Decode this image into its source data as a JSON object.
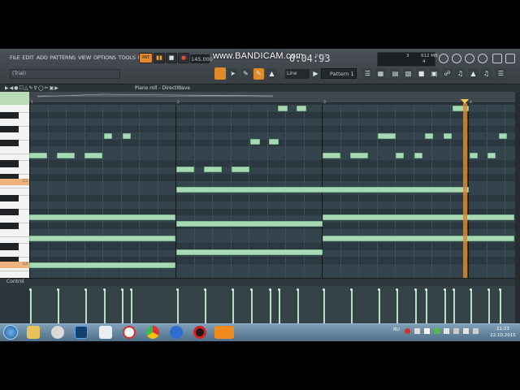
{
  "app": {
    "menu": [
      "FILE",
      "EDIT",
      "ADD",
      "PATTERNS",
      "VIEW",
      "OPTIONS",
      "TOOLS",
      "HELP"
    ],
    "hint": "(Trial)",
    "pat_label": "PAT",
    "tempo": "145.000",
    "watermark": "www.BANDICAM.com",
    "time": "0:04:93",
    "time_sub": "M:S:CS",
    "cpu_value": "3",
    "memory": "612 MB",
    "cpu_poly": "4",
    "snap_mode": "Line",
    "pattern": "Pattern 1",
    "accent": "#e08a2a"
  },
  "piano_roll": {
    "title": "Piano roll - DirectWave",
    "bars": [
      "1",
      "2",
      "3",
      "4"
    ],
    "key_labels": {
      "c5": "C5",
      "c4": "C4"
    },
    "note_color": "#a8d8b4",
    "notes": [
      {
        "row": 4,
        "start": 0.68,
        "len": 0.13,
        "label": "D5"
      },
      {
        "row": 7,
        "start": 3.78,
        "len": 0.07,
        "label": "C5"
      },
      {
        "row": 7,
        "start": 3.91,
        "len": 0.07,
        "label": "C5"
      },
      {
        "row": 7,
        "start": 3.56,
        "len": 0.12,
        "label": "C5"
      },
      {
        "row": 7,
        "start": 5.79,
        "len": 0.12,
        "label": "C5"
      },
      {
        "row": 12,
        "start": 1.05,
        "len": 0.07,
        "label": "A4"
      },
      {
        "row": 12,
        "start": 1.18,
        "len": 0.07,
        "label": "A4"
      },
      {
        "row": 12,
        "start": 3.05,
        "len": 0.07,
        "label": "A4"
      },
      {
        "row": 12,
        "start": 3.18,
        "len": 0.07,
        "label": "A4"
      },
      {
        "row": 12,
        "start": 5.05,
        "len": 0.12,
        "label": "A4"
      },
      {
        "row": 12,
        "start": 5.34,
        "len": 0.07,
        "label": "A4"
      },
      {
        "row": 12,
        "start": 5.47,
        "len": 0.07,
        "label": "A4"
      },
      {
        "row": 12,
        "start": 6.06,
        "len": 0.07,
        "label": "A4"
      },
      {
        "row": 14,
        "start": 1.88,
        "len": 0.12,
        "label": "G4"
      }
    ]
  },
  "control": {
    "label": "Control",
    "velocity_count": 24
  },
  "taskbar": {
    "lang": "RU",
    "time": "11:23",
    "date": "22.10.2015"
  }
}
